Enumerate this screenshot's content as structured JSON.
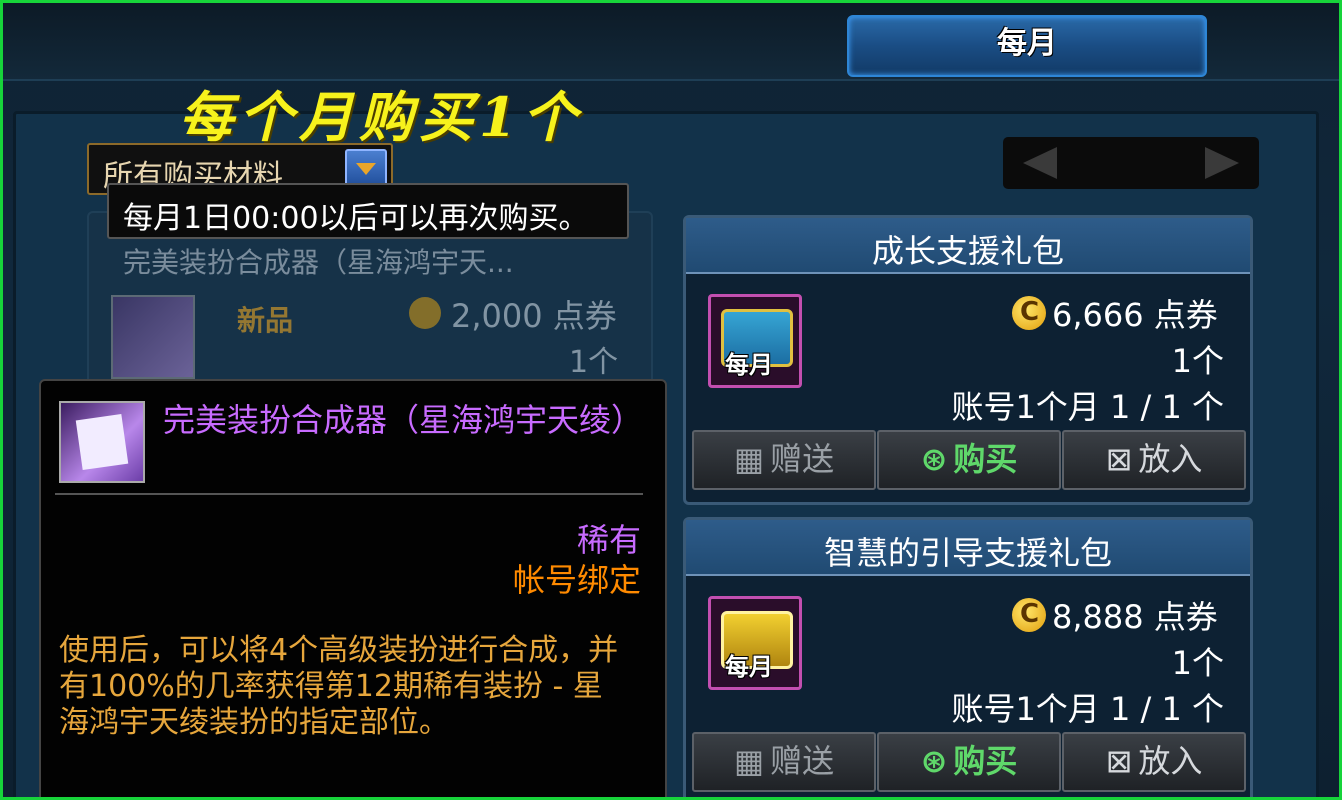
{
  "header": {
    "tab_label": "每月"
  },
  "overlay_caption": "每个月购买1个",
  "filter": {
    "label": "所有购买材料"
  },
  "tooltip_bar": {
    "text": "每月1日00:00以后可以再次购买。"
  },
  "left_card": {
    "title": "完美装扮合成器（星海鸿宇天...",
    "badge": "新品",
    "price": "2,000 点券",
    "qty": "1个"
  },
  "detail": {
    "name": "完美装扮合成器（星海鸿宇天绫）",
    "rarity": "稀有",
    "bind": "帐号绑定",
    "description": "使用后，可以将4个高级装扮进行合成，并有100%的几率获得第12期稀有装扮 - 星海鸿宇天绫装扮的指定部位。",
    "colors": {
      "name": "#c86bff",
      "bind": "#ff8a00",
      "desc": "#e6a63c"
    }
  },
  "products": [
    {
      "title": "成长支援礼包",
      "icon_tag": "每月",
      "price": "6,666 点券",
      "qty": "1个",
      "limit": "账号1个月 1 / 1 个",
      "buttons": {
        "gift": "赠送",
        "buy": "购买",
        "cart": "放入"
      }
    },
    {
      "title": "智慧的引导支援礼包",
      "icon_tag": "每月",
      "price": "8,888 点券",
      "qty": "1个",
      "limit": "账号1个月 1 / 1 个",
      "buttons": {
        "gift": "赠送",
        "buy": "购买",
        "cart": "放入"
      }
    }
  ],
  "frame_color": "#17d43a"
}
